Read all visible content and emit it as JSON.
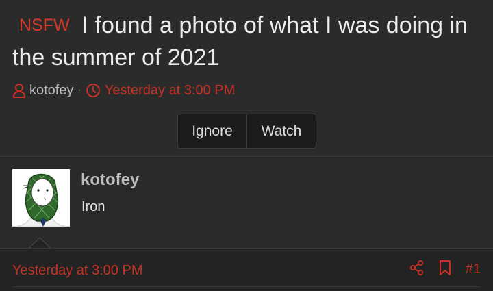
{
  "thread": {
    "prefix": "NSFW",
    "title": "I found a photo of what I was doing in the summer of 2021",
    "author": "kotofey",
    "separator": "·",
    "date": "Yesterday at 3:00 PM"
  },
  "buttons": {
    "ignore_label": "Ignore",
    "watch_label": "Watch"
  },
  "post": {
    "username": "kotofey",
    "user_title": "Iron",
    "date": "Yesterday at 3:00 PM",
    "number": "#1"
  },
  "icons": {
    "author": "user-icon",
    "time": "clock-icon",
    "share": "share-icon",
    "bookmark": "bookmark-icon"
  },
  "colors": {
    "accent": "#c63226",
    "background": "#2b2b2b",
    "button_bg": "#1c1c1c"
  }
}
